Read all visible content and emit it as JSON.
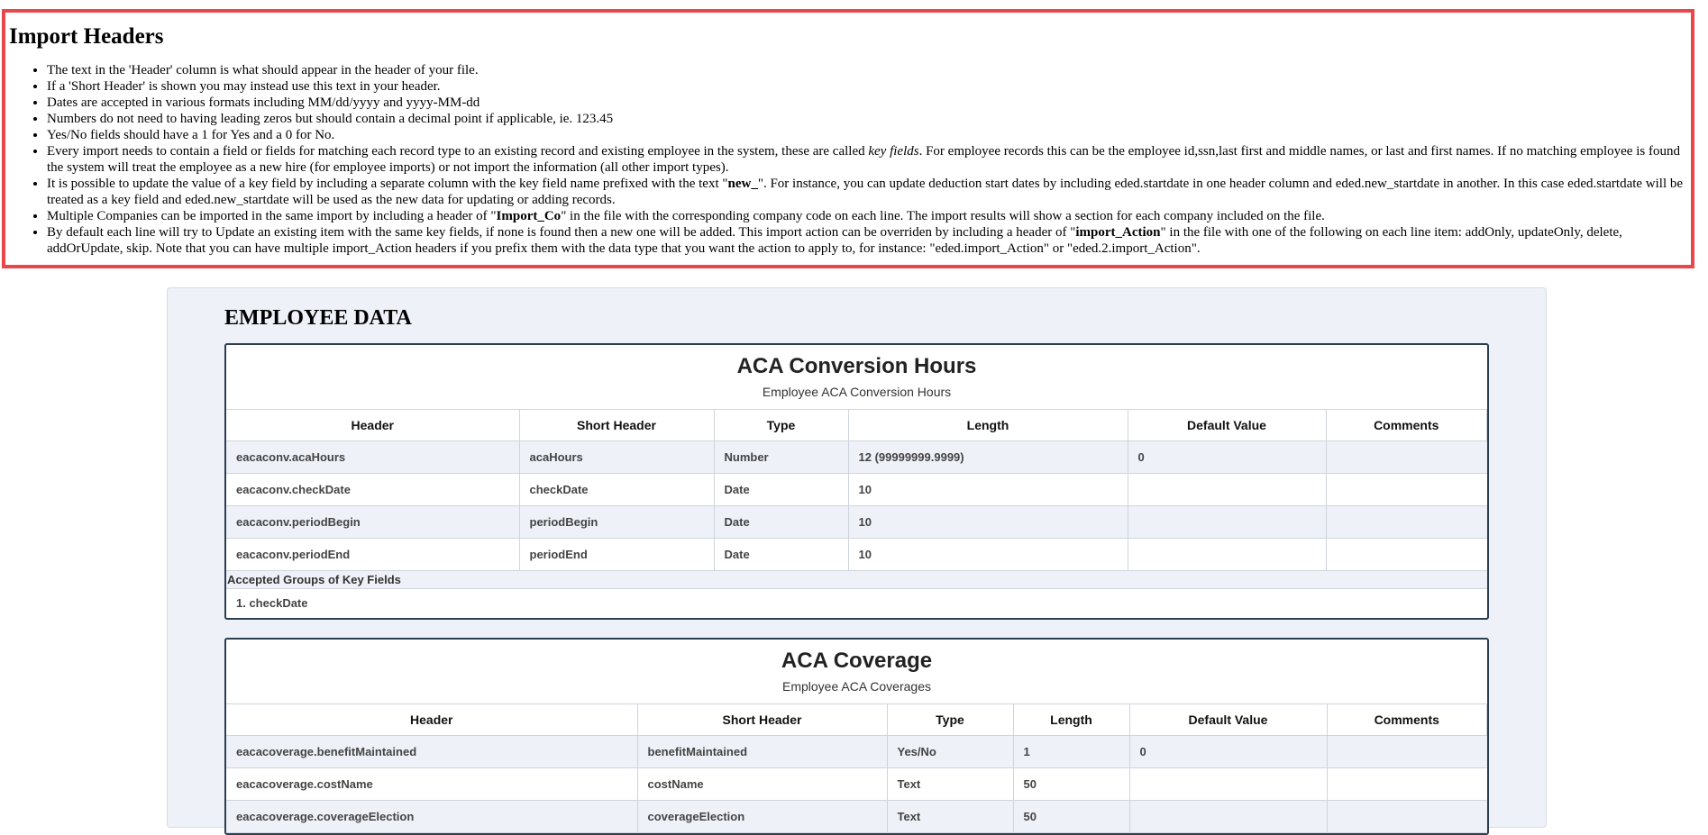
{
  "import_headers": {
    "title": "Import Headers",
    "bullets": [
      [
        {
          "t": "The text in the 'Header' column is what should appear in the header of your file."
        }
      ],
      [
        {
          "t": "If a 'Short Header' is shown you may instead use this text in your header."
        }
      ],
      [
        {
          "t": "Dates are accepted in various formats including MM/dd/yyyy and yyyy-MM-dd"
        }
      ],
      [
        {
          "t": "Numbers do not need to having leading zeros but should contain a decimal point if applicable, ie. 123.45"
        }
      ],
      [
        {
          "t": "Yes/No fields should have a 1 for Yes and a 0 for No."
        }
      ],
      [
        {
          "t": "Every import needs to contain a field or fields for matching each record type to an existing record and existing employee in the system, these are called "
        },
        {
          "t": "key fields",
          "s": "i"
        },
        {
          "t": ". For employee records this can be the employee id,ssn,last first and middle names, or last and first names. If no matching employee is found the system will treat the employee as a new hire (for employee imports) or not import the information (all other import types)."
        }
      ],
      [
        {
          "t": "It is possible to update the value of a key field by including a separate column with the key field name prefixed with the text \""
        },
        {
          "t": "new_",
          "s": "b"
        },
        {
          "t": "\". For instance, you can update deduction start dates by including eded.startdate in one header column and eded.new_startdate in another. In this case eded.startdate will be treated as a key field and eded.new_startdate will be used as the new data for updating or adding records."
        }
      ],
      [
        {
          "t": "Multiple Companies can be imported in the same import by including a header of \""
        },
        {
          "t": "Import_Co",
          "s": "b"
        },
        {
          "t": "\" in the file with the corresponding company code on each line. The import results will show a section for each company included on the file."
        }
      ],
      [
        {
          "t": "By default each line will try to Update an existing item with the same key fields, if none is found then a new one will be added. This import action can be overriden by including a header of \""
        },
        {
          "t": "import_Action",
          "s": "b"
        },
        {
          "t": "\" in the file with one of the following on each line item: addOnly, updateOnly, delete, addOrUpdate, skip. Note that you can have multiple import_Action headers if you prefix them with the data type that you want the action to apply to, for instance: \"eded.import_Action\" or \"eded.2.import_Action\"."
        }
      ]
    ]
  },
  "employee_data": {
    "heading": "EMPLOYEE DATA",
    "columns": [
      "Header",
      "Short Header",
      "Type",
      "Length",
      "Default Value",
      "Comments"
    ],
    "sections": [
      {
        "title": "ACA Conversion Hours",
        "subtitle": "Employee ACA Conversion Hours",
        "rows": [
          [
            "eacaconv.acaHours",
            "acaHours",
            "Number",
            "12 (99999999.9999)",
            "0",
            ""
          ],
          [
            "eacaconv.checkDate",
            "checkDate",
            "Date",
            "10",
            "",
            ""
          ],
          [
            "eacaconv.periodBegin",
            "periodBegin",
            "Date",
            "10",
            "",
            ""
          ],
          [
            "eacaconv.periodEnd",
            "periodEnd",
            "Date",
            "10",
            "",
            ""
          ]
        ],
        "key_fields_label": "Accepted Groups of Key Fields",
        "key_fields": [
          "1. checkDate"
        ]
      },
      {
        "title": "ACA Coverage",
        "subtitle": "Employee ACA Coverages",
        "rows": [
          [
            "eacacoverage.benefitMaintained",
            "benefitMaintained",
            "Yes/No",
            "1",
            "0",
            ""
          ],
          [
            "eacacoverage.costName",
            "costName",
            "Text",
            "50",
            "",
            ""
          ],
          [
            "eacacoverage.coverageElection",
            "coverageElection",
            "Text",
            "50",
            "",
            ""
          ]
        ]
      }
    ]
  }
}
